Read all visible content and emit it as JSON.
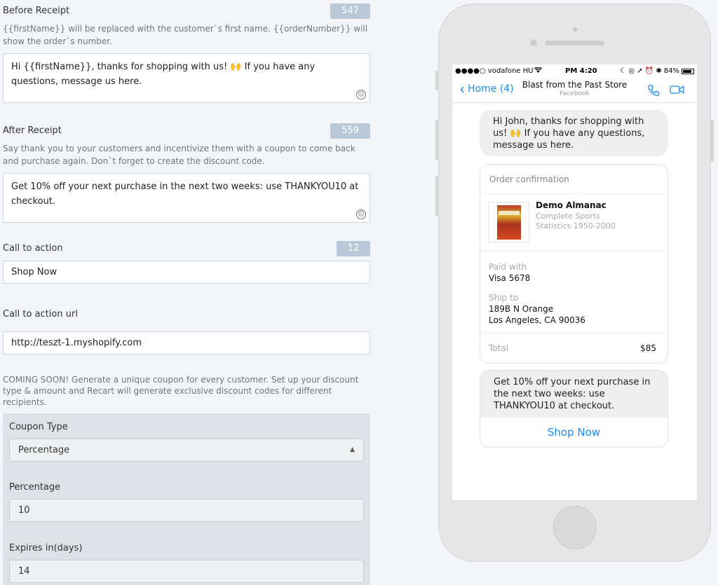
{
  "before_receipt": {
    "label": "Before Receipt",
    "counter": "547",
    "help": "{{firstName}} will be replaced with the customer`s first name. {{orderNumber}} will show the order`s number.",
    "value": "Hi {{firstName}}, thanks for shopping with us! 🙌 If you have any questions, message us here."
  },
  "after_receipt": {
    "label": "After Receipt",
    "counter": "559",
    "help": "Say thank you to your customers and incentivize them with a coupon to come back and purchase again. Don`t forget to create the discount code.",
    "value": "Get 10% off your next purchase in the next two weeks: use THANKYOU10 at checkout."
  },
  "call_to_action": {
    "label": "Call to action",
    "counter": "12",
    "value": "Shop Now"
  },
  "call_to_action_url": {
    "label": "Call to action url",
    "value": "http://teszt-1.myshopify.com"
  },
  "coming_soon": "COMING SOON! Generate a unique coupon for every customer. Set up your discount type & amount and Recart will generate exclusive discount codes for different recipients.",
  "coupon": {
    "type_label": "Coupon Type",
    "type_value": "Percentage",
    "percentage_label": "Percentage",
    "percentage_value": "10",
    "expires_label": "Expires in(days)",
    "expires_value": "14"
  },
  "phone": {
    "status": {
      "carrier": "●●●●○ vodafone HU",
      "time": "PM 4:20",
      "icons": "☾ ◎ ➚ ⏰ ✱",
      "battery": "84%"
    },
    "nav": {
      "back_label": "Home (4)",
      "title": "Blast from the Past Store",
      "subtitle": "Facebook"
    },
    "greeting": "Hi John, thanks for shopping with us! 🙌 If you have any questions, message us here.",
    "receipt": {
      "header": "Order confirmation",
      "item_name": "Demo Almanac",
      "item_sub": "Complete Sports Statistics 1950-2000",
      "paid_caption": "Paid with",
      "paid_value": "Visa 5678",
      "ship_caption": "Ship to",
      "ship_line1": "189B N Orange",
      "ship_line2": "Los Angeles, CA 90036",
      "total_label": "Total",
      "total_value": "$85"
    },
    "promo_text": "Get 10% off your next purchase in the next two weeks: use THANKYOU10 at checkout.",
    "promo_button": "Shop Now"
  },
  "colors": {
    "accent": "#1a8cf0",
    "counter_bg": "#b9c9d8",
    "page_bg": "#f3f5f8"
  }
}
